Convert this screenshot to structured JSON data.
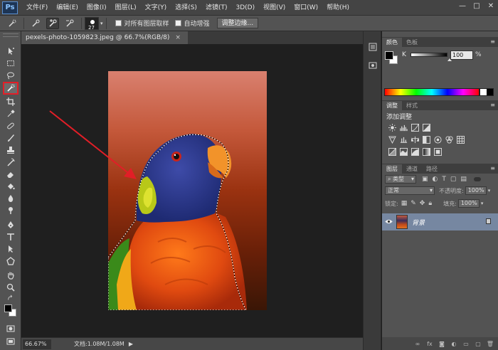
{
  "app": {
    "logo": "Ps"
  },
  "menu": [
    "文件(F)",
    "编辑(E)",
    "图像(I)",
    "图层(L)",
    "文字(Y)",
    "选择(S)",
    "滤镜(T)",
    "3D(D)",
    "视图(V)",
    "窗口(W)",
    "帮助(H)"
  ],
  "window_controls": {
    "minimize": "—",
    "maximize": "□",
    "close": "✕"
  },
  "options": {
    "brush_size": "27",
    "sample_all_layers": "对所有图层取样",
    "auto_enhance": "自动增强",
    "refine_edge": "调整边缘..."
  },
  "document": {
    "tab": "pexels-photo-1059823.jpeg @ 66.7%(RGB/8)",
    "close": "×"
  },
  "status": {
    "zoom": "66.67%",
    "doc": "文档:1.08M/1.08M",
    "arrow": "▶"
  },
  "panels": {
    "color_tabs": [
      "颜色",
      "色板"
    ],
    "k_label": "K",
    "k_value": "100",
    "k_unit": "%",
    "adjust_tabs": [
      "调整",
      "样式"
    ],
    "adjust_title": "添加调整",
    "layers_tabs": [
      "图层",
      "通道",
      "路径"
    ],
    "filter_kind": "类型",
    "blend_mode": "正常",
    "opacity_label": "不透明度:",
    "opacity_value": "100%",
    "lock_label": "锁定:",
    "fill_label": "填充:",
    "fill_value": "100%",
    "layer_name": "背景",
    "menu_glyph": "≡"
  },
  "colors": {
    "accent_red": "#e21e27",
    "selected_layer": "#7687a1"
  },
  "icons": {
    "tools": [
      "move-icon",
      "marquee-icon",
      "lasso-icon",
      "quick-selection-icon",
      "crop-icon",
      "eyedropper-icon",
      "healing-brush-icon",
      "brush-icon",
      "clone-stamp-icon",
      "history-brush-icon",
      "eraser-icon",
      "paint-bucket-icon",
      "blur-icon",
      "dodge-icon",
      "pen-icon",
      "type-icon",
      "path-selection-icon",
      "shape-icon",
      "hand-icon",
      "zoom-icon"
    ]
  }
}
